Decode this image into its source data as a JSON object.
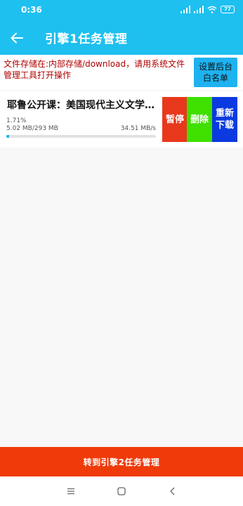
{
  "status_bar": {
    "time": "0:36",
    "battery": "77"
  },
  "app_bar": {
    "title": "引擎1任务管理",
    "back_icon": "arrow-left-icon"
  },
  "notice": {
    "text": "文件存储在:内部存储/download，请用系统文件管理工具打开操作"
  },
  "whitelist_button": {
    "line1": "设置后台",
    "line2": "白名单"
  },
  "task": {
    "title": "耶鲁公开课：美国现代主义文学…",
    "percent": "1.71%",
    "progress": 0.0171,
    "size": "5.02 MB/293 MB",
    "speed": "34.51 MB/s"
  },
  "actions": {
    "pause": {
      "line1": "暂停",
      "line2": ""
    },
    "delete": {
      "line1": "删除",
      "line2": ""
    },
    "redownload": {
      "line1": "重新",
      "line2": "下载"
    }
  },
  "bottom_button": {
    "label": "转到引擎2任务管理"
  },
  "colors": {
    "accent": "#1ec0f0",
    "pause": "#e8381c",
    "delete": "#3fe000",
    "redownload": "#0a3ae0",
    "bottom": "#ef3b0a"
  }
}
